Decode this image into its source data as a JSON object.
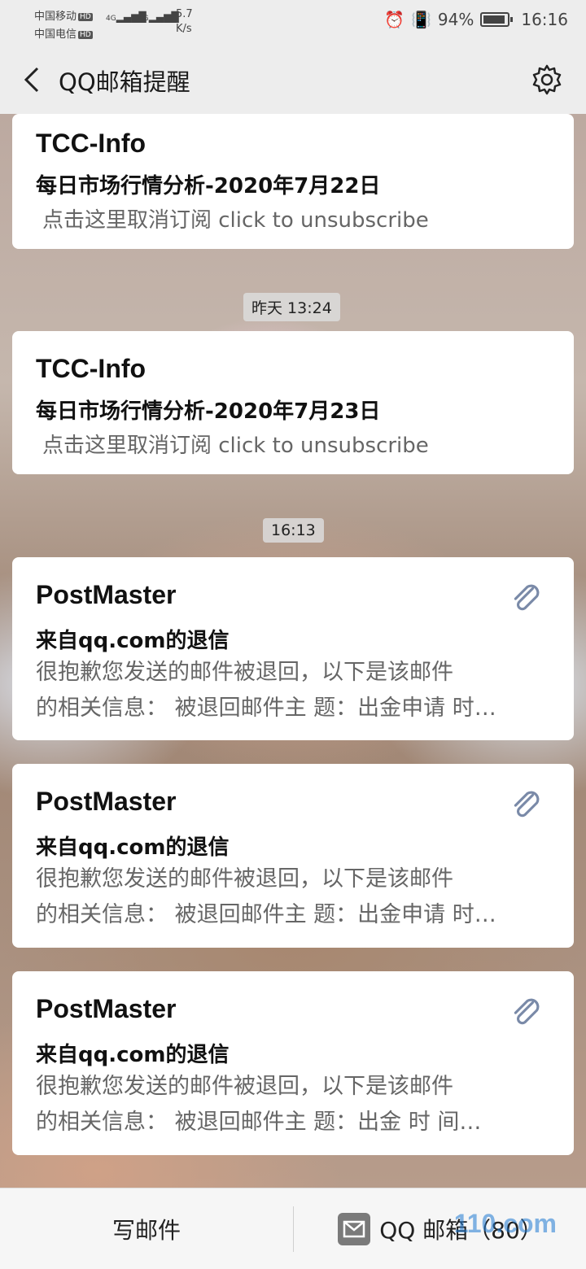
{
  "status": {
    "carrier1": "中国移动",
    "carrier2": "中国电信",
    "hd": "HD",
    "net": "4G",
    "speed_value": "5.7",
    "speed_unit": "K/s",
    "battery": "94%",
    "time": "16:16"
  },
  "nav": {
    "title": "QQ邮箱提醒",
    "back_icon": "chevron-left-icon",
    "settings_icon": "gear-icon"
  },
  "messages": [
    {
      "sender": "TCC-Info",
      "subject": "每日市场行情分析-2020年7月22日",
      "desc": "点击这里取消订阅 click to unsubscribe"
    },
    {
      "time_chip": "昨天 13:24",
      "sender": "TCC-Info",
      "subject": "每日市场行情分析-2020年7月23日",
      "desc": "点击这里取消订阅 click to unsubscribe"
    },
    {
      "time_chip": "16:13",
      "sender": "PostMaster",
      "subject": "来自qq.com的退信",
      "line1": "很抱歉您发送的邮件被退回，以下是该邮件",
      "line2": "的相关信息： 被退回邮件主 题：出金申请 时…",
      "attachment_icon": "paperclip-icon"
    },
    {
      "sender": "PostMaster",
      "subject": "来自qq.com的退信",
      "line1": "很抱歉您发送的邮件被退回，以下是该邮件",
      "line2": "的相关信息： 被退回邮件主 题：出金申请 时…",
      "attachment_icon": "paperclip-icon"
    },
    {
      "sender": "PostMaster",
      "subject": "来自qq.com的退信",
      "line1": "很抱歉您发送的邮件被退回，以下是该邮件",
      "line2": "的相关信息： 被退回邮件主 题：出金 时 间…",
      "attachment_icon": "paperclip-icon"
    }
  ],
  "bottom": {
    "write_label": "写邮件",
    "mailbox_label": "QQ 邮箱（80）",
    "mail_icon": "envelope-icon",
    "watermark": "110.com"
  },
  "colors": {
    "bar_bg": "#ededed",
    "card_bg": "#ffffff",
    "clip_color": "#7a8aa8"
  }
}
